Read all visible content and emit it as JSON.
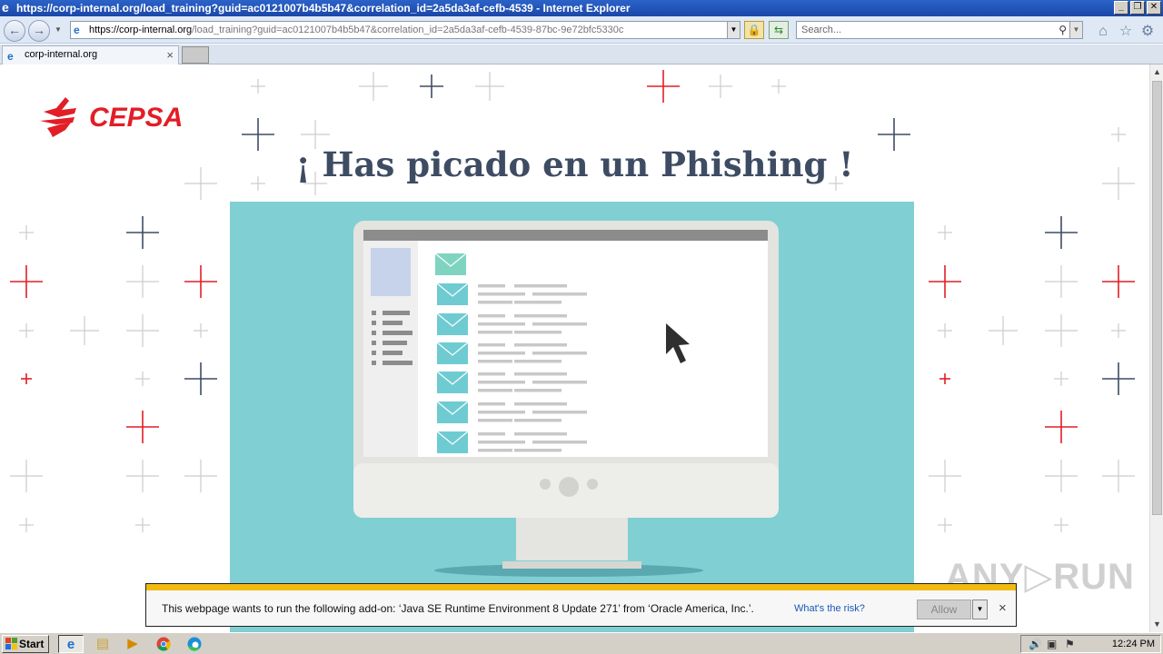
{
  "window": {
    "title": "https://corp-internal.org/load_training?guid=ac0121007b4b5b47&correlation_id=2a5da3af-cefb-4539 - Internet Explorer",
    "minimize_label": "_",
    "restore_label": "❐",
    "close_label": "✕"
  },
  "toolbar": {
    "back_glyph": "←",
    "forward_glyph": "→",
    "address_host": "https://corp-internal.org",
    "address_path": "/load_training?guid=ac0121007b4b5b47&correlation_id=2a5da3af-cefb-4539-87bc-9e72bfc5330c",
    "search_placeholder": "Search...",
    "home_icon": "home-icon",
    "favorites_icon": "star-icon",
    "settings_icon": "gear-icon"
  },
  "tab": {
    "label": "corp-internal.org",
    "close_glyph": "×"
  },
  "page": {
    "brand": "CEPSA",
    "brand_color": "#e21e26",
    "headline": "¡ Has picado en un Phishing !",
    "headline_color": "#3e4c63",
    "hero_bg": "#7fcfd3"
  },
  "infobar": {
    "message": "This webpage wants to run the following add-on: ‘Java SE Runtime Environment 8 Update 271’ from ‘Oracle America, Inc.’.",
    "risk_link": "What's the risk?",
    "allow_label": "Allow",
    "close_glyph": "×",
    "stripe_color": "#f2b90f"
  },
  "watermark": "ANY▷RUN",
  "taskbar": {
    "start_label": "Start",
    "clock": "12:24 PM"
  }
}
